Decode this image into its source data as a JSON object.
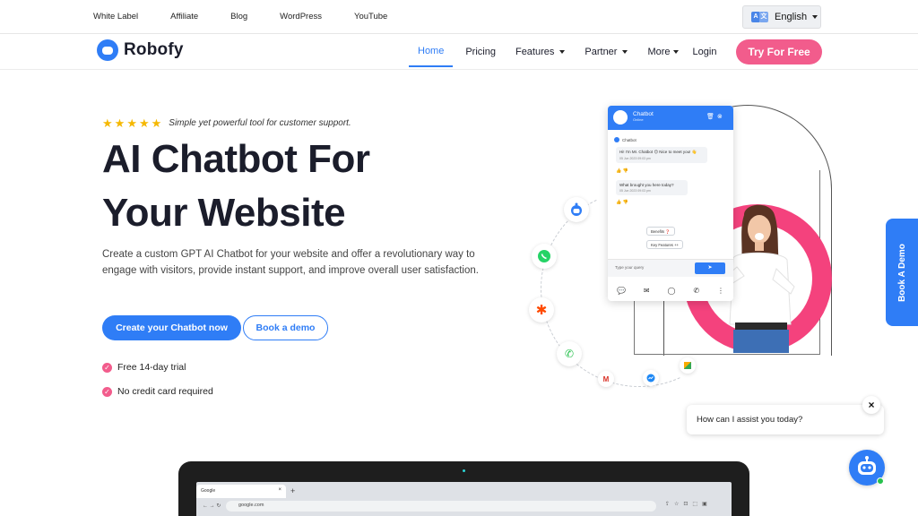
{
  "topbar": {
    "links": [
      "White Label",
      "Affiliate",
      "Blog",
      "WordPress",
      "YouTube"
    ],
    "language": "English"
  },
  "nav": {
    "brand": "Robofy",
    "items": [
      {
        "label": "Home",
        "active": true,
        "dropdown": false
      },
      {
        "label": "Pricing",
        "active": false,
        "dropdown": false
      },
      {
        "label": "Features",
        "active": false,
        "dropdown": true
      },
      {
        "label": "Partner",
        "active": false,
        "dropdown": true
      },
      {
        "label": "More",
        "active": false,
        "dropdown": true
      },
      {
        "label": "Login",
        "active": false,
        "dropdown": false
      }
    ],
    "cta": "Try For Free"
  },
  "hero": {
    "rating_stars": 5,
    "tagline": "Simple yet powerful tool for customer support.",
    "title_line1": "AI Chatbot For",
    "title_line2": "Your Website",
    "description": "Create a custom GPT AI Chatbot for your website and offer a revolutionary way to engage with visitors, provide instant support, and improve overall user satisfaction.",
    "primary_cta": "Create your Chatbot now",
    "secondary_cta": "Book a demo",
    "checks": [
      "Free 14-day trial",
      "No credit card required"
    ]
  },
  "chat_preview": {
    "header_title": "Chatbot",
    "header_status": "Online",
    "bot_label": "Chatbot",
    "messages": [
      {
        "text": "Hi! I'm Mr. Chatbot 😊 Nice to meet you! 👋",
        "time": "05 Jun 2023 09:03 pm"
      },
      {
        "text": "What brought you here today?",
        "time": "05 Jun 2023 09:03 pm"
      }
    ],
    "chips": [
      "Benefits ❓",
      "Key Features ++"
    ],
    "input_placeholder": "Type your query"
  },
  "side_tab": "Book A Demo",
  "assist": {
    "message": "How can I assist you today?",
    "close": "×"
  },
  "laptop": {
    "tab_title": "Google",
    "url": "google.com"
  },
  "colors": {
    "primary": "#2f7df6",
    "accent": "#f25c8c",
    "star": "#f5b800",
    "online": "#27c14d"
  }
}
